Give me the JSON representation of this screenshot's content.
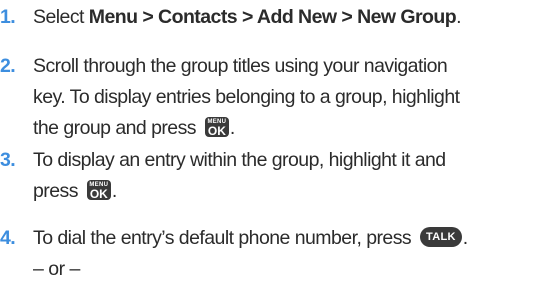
{
  "steps": [
    {
      "number": "1.",
      "prefix": "Select ",
      "path": "Menu > Contacts > Add New > New Group",
      "suffix": "."
    },
    {
      "number": "2.",
      "line1": "Scroll through the group titles using your navigation",
      "line2": "key. To display entries belonging to a group, highlight",
      "line3_prefix": "the group and press ",
      "key_small": "MENU",
      "key_big": "OK",
      "line3_suffix": "."
    },
    {
      "number": "3.",
      "line1": "To display an entry within the group, highlight it and",
      "line2_prefix": "press ",
      "key_small": "MENU",
      "key_big": "OK",
      "line2_suffix": "."
    },
    {
      "number": "4.",
      "line1_prefix": "To dial the entry’s default phone number, press ",
      "key": "TALK",
      "line1_suffix": "."
    }
  ],
  "or_separator": "– or –"
}
